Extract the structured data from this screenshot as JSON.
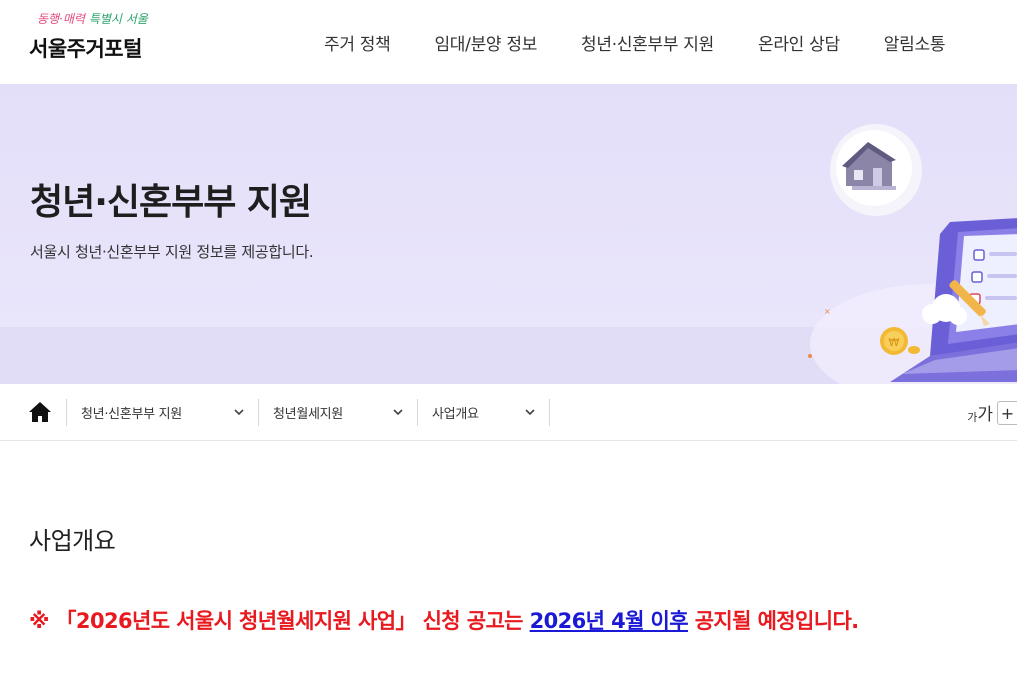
{
  "header": {
    "slogan_pink": "동행·매력",
    "slogan_green": "특별시 서울",
    "title": "서울주거포털",
    "nav": [
      "주거 정책",
      "임대/분양 정보",
      "청년·신혼부부 지원",
      "온라인 상담",
      "알림소통"
    ]
  },
  "banner": {
    "title": "청년·신혼부부 지원",
    "subtitle": "서울시 청년·신혼부부 지원 정보를 제공합니다."
  },
  "location": {
    "crumbs": [
      "청년·신혼부부 지원",
      "청년월세지원",
      "사업개요"
    ],
    "font_small": "가",
    "font_large": "가",
    "font_plus": "+"
  },
  "content": {
    "section_title": "사업개요",
    "notice_prefix": "※ 「2026년도 서울시 청년월세지원 사업」 신청 공고는 ",
    "notice_link": "2026년 4월 이후",
    "notice_suffix": " 공지될 예정입니다."
  },
  "colors": {
    "banner_bg": "#e6e1fa",
    "notice": "#e8191f",
    "link": "#1a1ad6",
    "accent_purple": "#7b6fd9"
  }
}
